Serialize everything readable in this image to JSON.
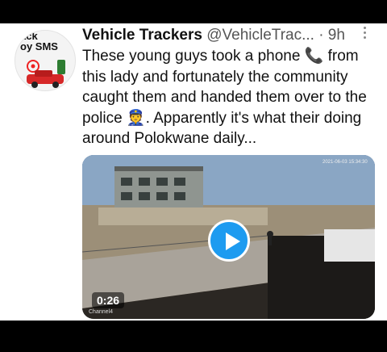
{
  "tweet": {
    "author_name": "Vehicle Trackers",
    "author_handle": "@VehicleTrac...",
    "time": "· 9h",
    "text": "These young guys took a phone 📞 from this lady and fortunately the community caught them and handed them over to the police 👮. Apparently it's what their doing around Polokwane daily..."
  },
  "avatar": {
    "text": "ack\noy SMS"
  },
  "video": {
    "duration": "0:26",
    "camera_label": "Channel4",
    "cam_stamp": "2021-06-03 15:34:30"
  },
  "icons": {
    "more": "more-vertical-icon",
    "play": "play-icon"
  },
  "colors": {
    "accent": "#1d9bf0"
  }
}
